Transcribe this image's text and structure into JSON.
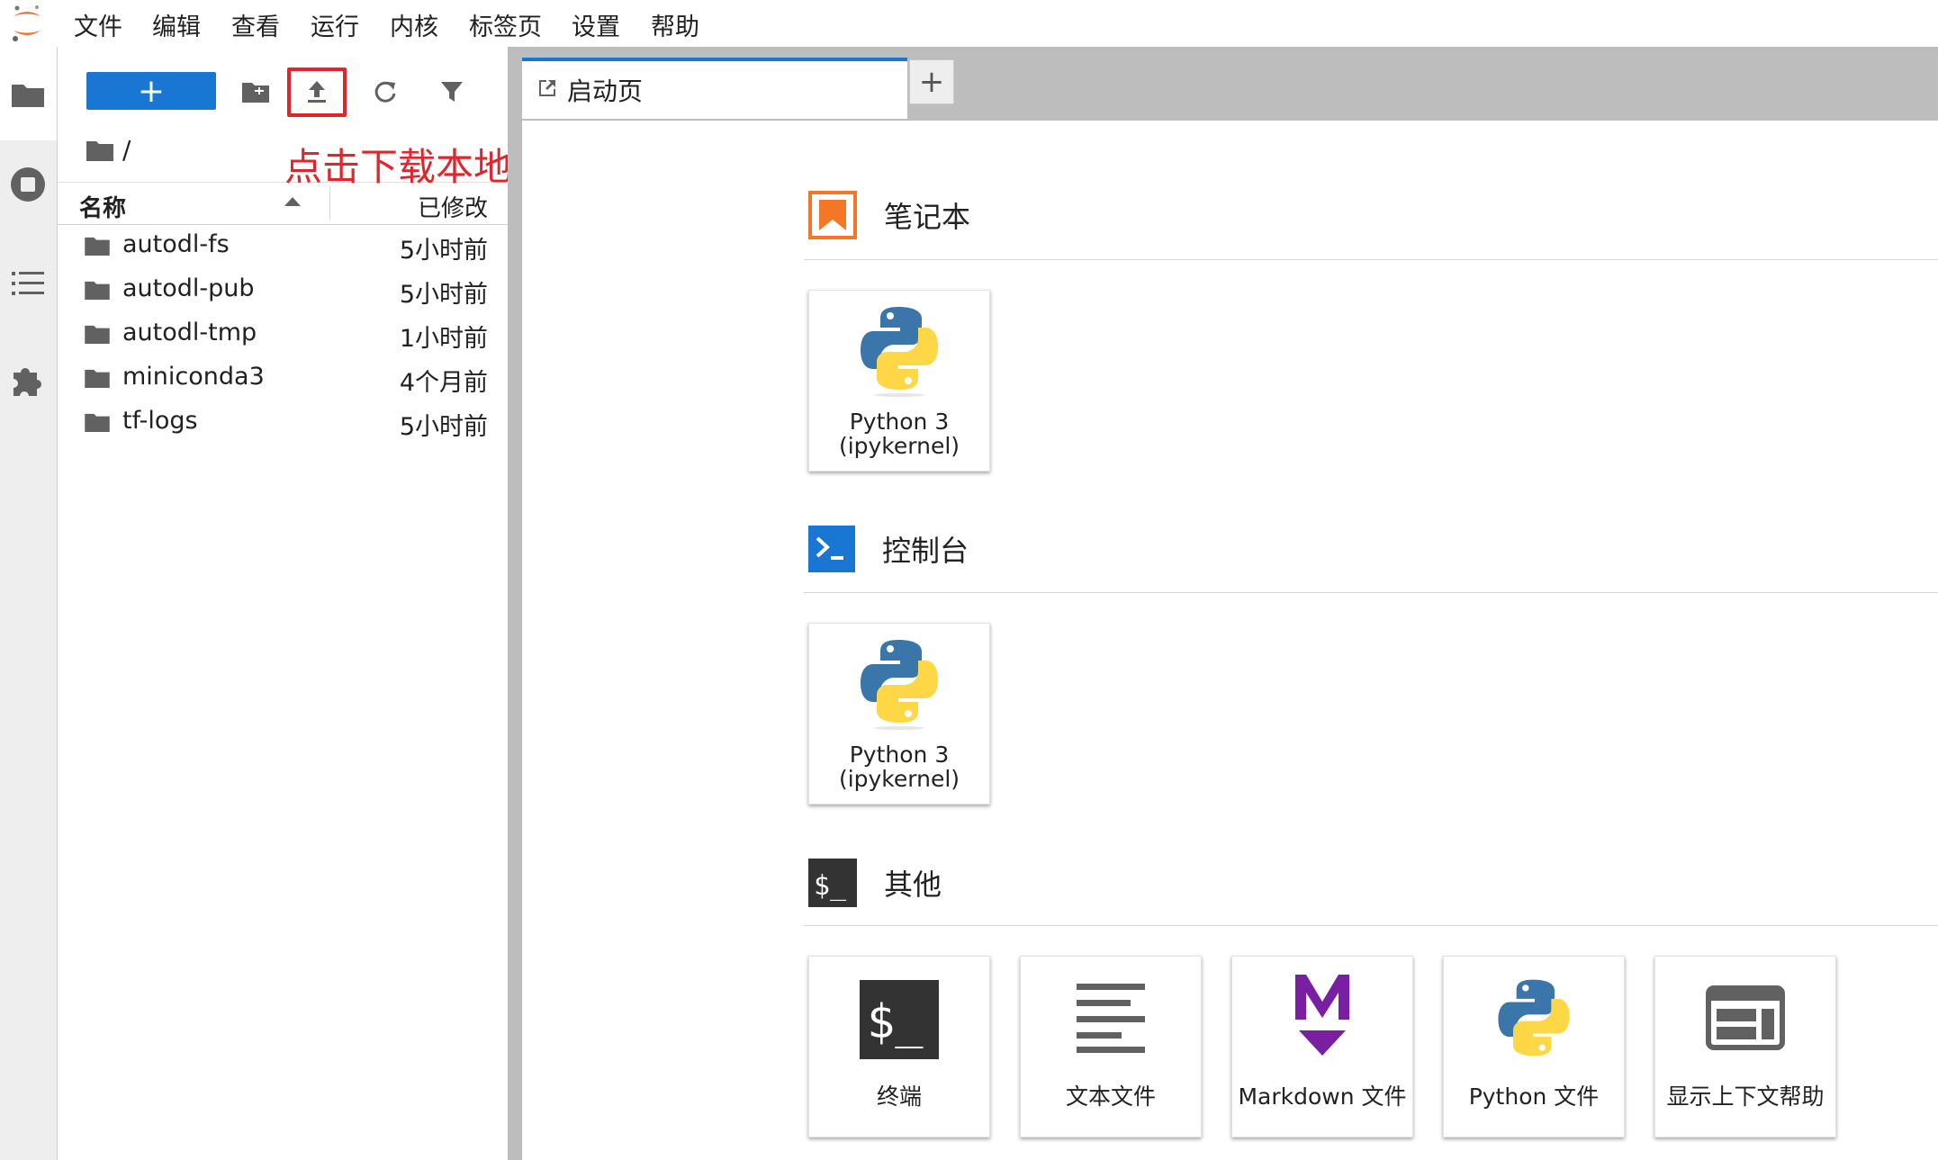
{
  "menubar": {
    "items": [
      "文件",
      "编辑",
      "查看",
      "运行",
      "内核",
      "标签页",
      "设置",
      "帮助"
    ]
  },
  "rail": {
    "icons": [
      "folder-icon",
      "running-icon",
      "toc-icon",
      "extension-icon"
    ]
  },
  "filebrowser": {
    "new_label": "+",
    "breadcrumb": "/",
    "header": {
      "name": "名称",
      "modified": "已修改"
    },
    "annotation": "点击下载本地文件到实例中",
    "files": [
      {
        "name": "autodl-fs",
        "modified": "5小时前"
      },
      {
        "name": "autodl-pub",
        "modified": "5小时前"
      },
      {
        "name": "autodl-tmp",
        "modified": "1小时前"
      },
      {
        "name": "miniconda3",
        "modified": "4个月前"
      },
      {
        "name": "tf-logs",
        "modified": "5小时前"
      }
    ]
  },
  "main": {
    "tab_label": "启动页",
    "add_tab": "+",
    "sections": {
      "notebook": {
        "title": "笔记本",
        "cards": [
          {
            "line1": "Python 3",
            "line2": "(ipykernel)"
          }
        ]
      },
      "console": {
        "title": "控制台",
        "cards": [
          {
            "line1": "Python 3",
            "line2": "(ipykernel)"
          }
        ]
      },
      "other": {
        "title": "其他",
        "cards": [
          {
            "label": "终端"
          },
          {
            "label": "文本文件"
          },
          {
            "label": "Markdown 文件"
          },
          {
            "label": "Python 文件"
          },
          {
            "label": "显示上下文帮助"
          }
        ]
      }
    }
  },
  "colors": {
    "accent": "#1976d2",
    "annotation": "#e1262b",
    "notebook_icon": "#f37726",
    "markdown": "#7b1fa2"
  }
}
